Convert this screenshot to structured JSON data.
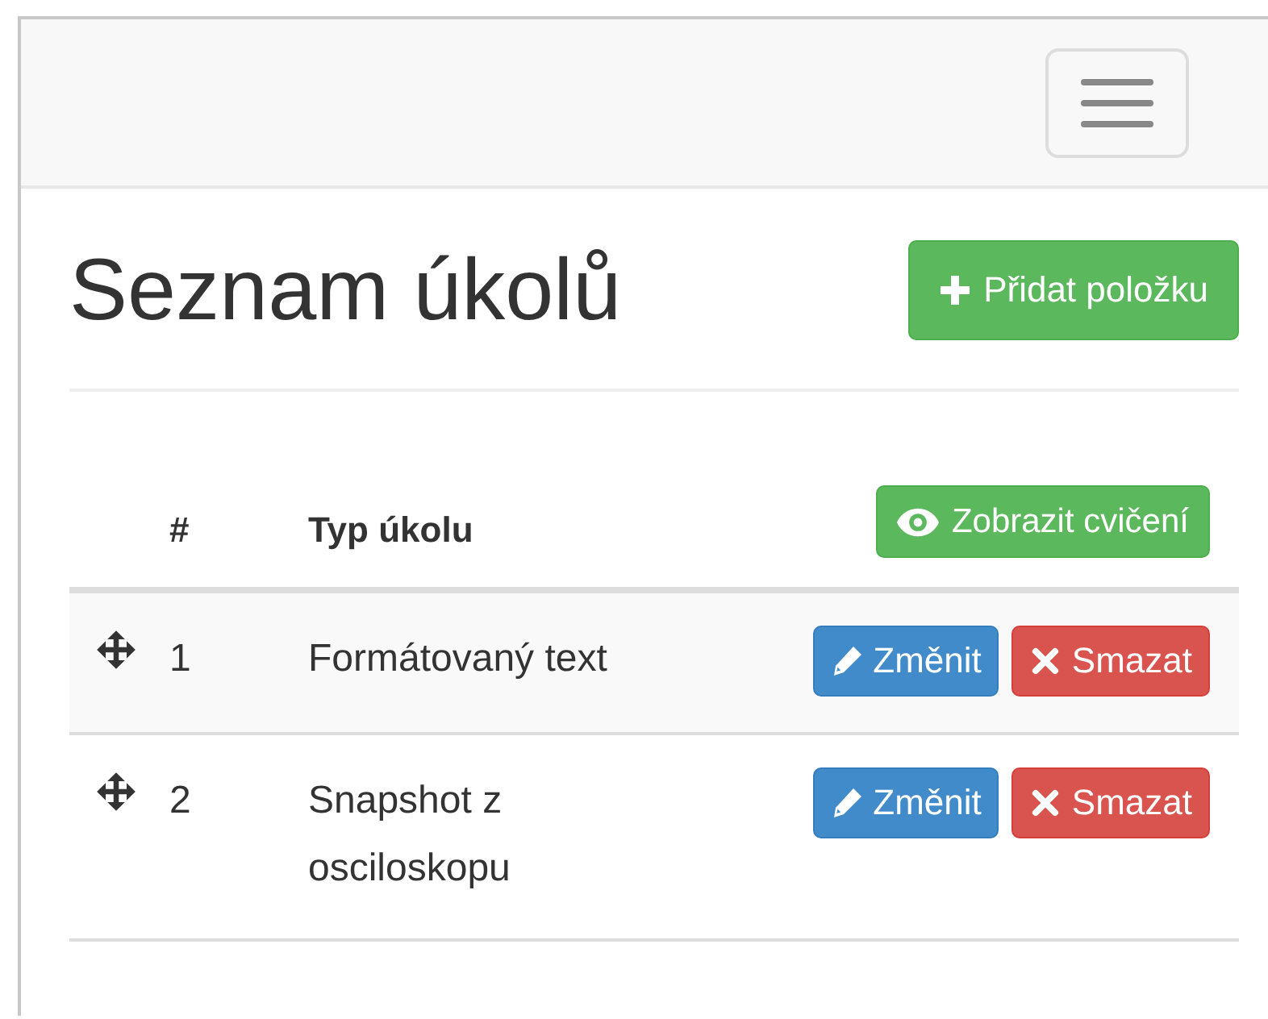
{
  "heading": "Seznam úkolů",
  "add_button": "Přidat položku",
  "table": {
    "columns": [
      "#",
      "Typ úkolu"
    ],
    "header_button": "Zobrazit cvičení",
    "rows": [
      {
        "number": "1",
        "type": "Formátovaný text",
        "buttons": [
          {
            "kind": "edit",
            "label": "Změnit"
          },
          {
            "kind": "delete",
            "label": "Smazat"
          }
        ]
      },
      {
        "number": "2",
        "type": "Snapshot z osciloskopu",
        "buttons": [
          {
            "kind": "edit",
            "label": "Změnit"
          },
          {
            "kind": "delete",
            "label": "Smazat"
          }
        ]
      }
    ]
  }
}
